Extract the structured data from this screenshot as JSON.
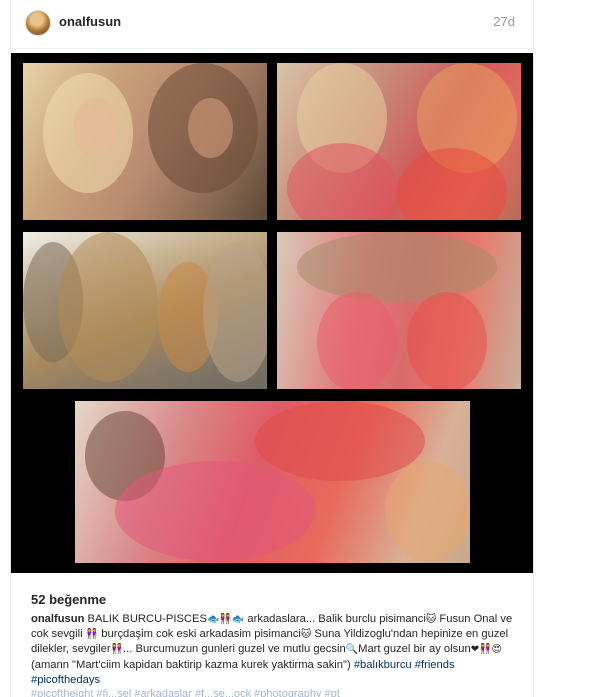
{
  "post": {
    "username": "onalfusun",
    "timestamp": "27d",
    "likes": "52 beğenme"
  },
  "photos": [
    {
      "name": "photo-two-women-portrait"
    },
    {
      "name": "photo-two-women-red-leotards"
    },
    {
      "name": "photo-cats"
    },
    {
      "name": "photo-two-women-lying-hair-spread"
    },
    {
      "name": "photo-two-women-reclining"
    }
  ],
  "caption": {
    "author": "onalfusun",
    "segment1": " BALIK BURCU-PISCES",
    "emoji1": "🐟👭🐟",
    "segment2": " arkadaslara... Balik burclu pisimanci",
    "emoji2": "🐱",
    "segment3": " Fusun Onal ve cok sevgili ",
    "emoji3": "👭",
    "segment4": " burçdaşim cok eski arkadasim pisimanci",
    "emoji4": "🐱",
    "segment5": " Suna Yildizoglu'ndan hepinize en guzel dilekler, sevgiler",
    "emoji5": "👭",
    "segment6": "... Burcumuzun gunleri guzel ve mutlu gecsin",
    "emoji6": "🔍",
    "segment7": "Mart guzel bir ay olsun",
    "emoji7": "❤👭😍",
    "segment8": " (amann \"Mart'ciim kapidan baktirip kazma kurek yaktirma sakin\") ",
    "tags": "#balıkburcu #friends #picofthedays"
  },
  "cut_off_text": "#picoftheight #fi...sel #arkadaslar #f...se...ock #photography #pt"
}
